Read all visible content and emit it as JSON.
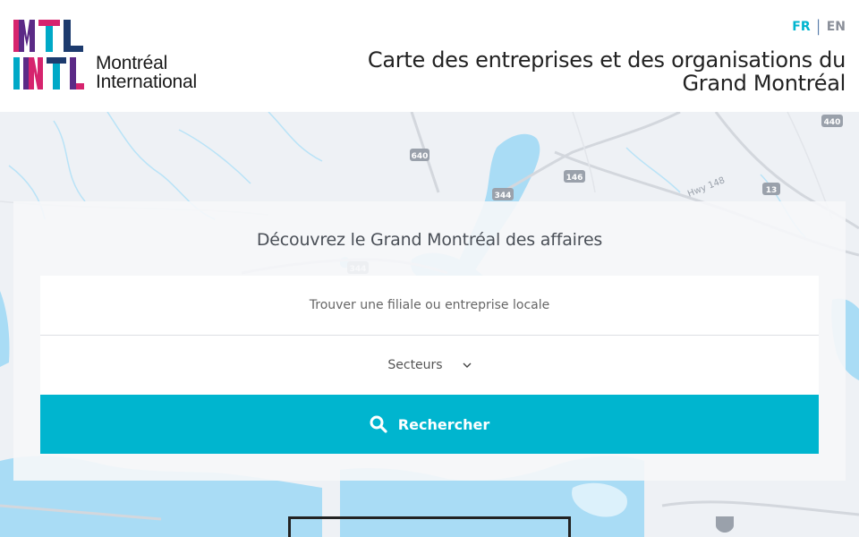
{
  "header": {
    "logo": {
      "mark_top": "MTL",
      "mark_bottom": "INTL",
      "line1": "Montréal",
      "line2": "International"
    },
    "language": {
      "fr": "FR",
      "separator": "|",
      "en": "EN"
    },
    "title": "Carte des entreprises et des organisations du Grand Montréal"
  },
  "map": {
    "road_labels": [
      "640",
      "344",
      "146",
      "13",
      "440",
      "344",
      "Hwy 148"
    ]
  },
  "search": {
    "heading": "Découvrez le Grand Montréal des affaires",
    "placeholder": "Trouver une filiale ou entreprise locale",
    "sector_label": "Secteurs",
    "button_label": "Rechercher"
  },
  "colors": {
    "accent": "#00b5cf",
    "water": "#a9dcf5",
    "logo_magenta": "#d6246e",
    "logo_purple": "#5b2a86",
    "logo_teal": "#00a9c7",
    "logo_navy": "#1d3b6e"
  }
}
